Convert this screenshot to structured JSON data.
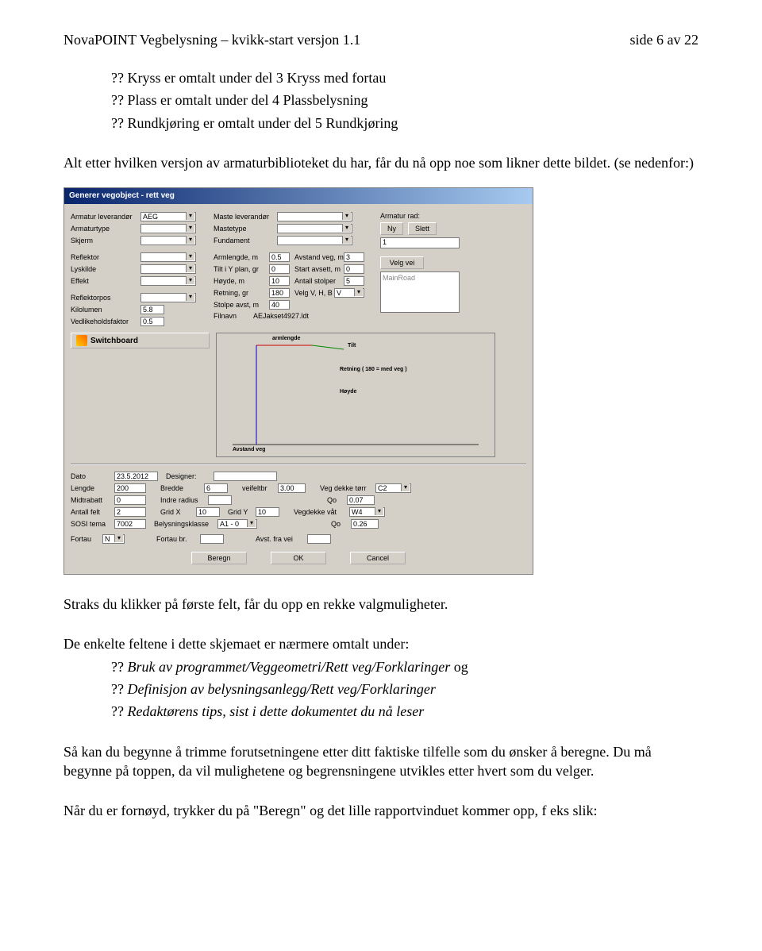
{
  "header": {
    "title": "NovaPOINT Vegbelysning – kvikk-start versjon 1.1",
    "page": "side 6 av 22"
  },
  "intro": {
    "l1": "?? Kryss er omtalt under del 3 Kryss med fortau",
    "l2": "?? Plass er omtalt under del 4 Plassbelysning",
    "l3": "?? Rundkjøring er omtalt under del 5 Rundkjøring"
  },
  "para1": "Alt etter hvilken versjon av armaturbiblioteket du har, får du nå opp noe som likner dette bildet. (se nedenfor:)",
  "dialog": {
    "title": "Generer vegobject - rett veg",
    "armatur": {
      "lev_lbl": "Armatur leverandør",
      "lev_val": "AEG",
      "typ_lbl": "Armaturtype",
      "skj_lbl": "Skjerm",
      "ref_lbl": "Reflektor",
      "lys_lbl": "Lyskilde",
      "eff_lbl": "Effekt",
      "rpos_lbl": "Reflektorpos",
      "kilo_lbl": "Kilolumen",
      "kilo_val": "5.8",
      "vedl_lbl": "Vedlikeholdsfaktor",
      "vedl_val": "0.5"
    },
    "maste": {
      "lev_lbl": "Maste leverandør",
      "typ_lbl": "Mastetype",
      "fund_lbl": "Fundament",
      "arm_lbl": "Armlengde, m",
      "arm_val": "0.5",
      "tilt_lbl": "Tilt i Y plan, gr",
      "tilt_val": "0",
      "hoy_lbl": "Høyde, m",
      "hoy_val": "10",
      "ret_lbl": "Retning, gr",
      "ret_val": "180",
      "stop_lbl": "Stolpe avst, m",
      "stop_val": "40",
      "fil_lbl": "Filnavn",
      "fil_val": "AEJakset4927.ldt"
    },
    "geo": {
      "avs_lbl": "Avstand veg, m",
      "avs_val": "3",
      "sta_lbl": "Start avsett, m",
      "sta_val": "0",
      "ant_lbl": "Antall stolper",
      "ant_val": "5",
      "velg_lbl": "Velg V, H, B",
      "velg_val": "V",
      "mainroad": "MainRoad"
    },
    "rad": {
      "lbl": "Armatur rad:",
      "ny": "Ny",
      "slett": "Slett",
      "val": "1",
      "velg_btn": "Velg vei"
    },
    "switchboard": "Switchboard",
    "preview": {
      "arm_lbl": "armlengde",
      "tilt_lbl": "Tilt",
      "retn_lbl": "Retning ( 180 = med veg )",
      "hoyde_lbl": "Høyde",
      "avst_lbl": "Avstand veg"
    },
    "bottom": {
      "dato_lbl": "Dato",
      "dato_val": "23.5.2012",
      "designer_lbl": "Designer:",
      "len_lbl": "Lengde",
      "len_val": "200",
      "bre_lbl": "Bredde",
      "bre_val": "6",
      "vfb_lbl": "veifeltbr",
      "vfb_val": "3.00",
      "vdt_lbl": "Veg dekke tørr",
      "vdt_val": "C2",
      "mid_lbl": "Midtrabatt",
      "mid_val": "0",
      "ind_lbl": "Indre radius",
      "ind_val": "",
      "qo1_lbl": "Qo",
      "qo1_val": "0.07",
      "ant_lbl": "Antall felt",
      "ant_val": "2",
      "gx_lbl": "Grid X",
      "gx_val": "10",
      "gy_lbl": "Grid Y",
      "gy_val": "10",
      "vdv_lbl": "Vegdekke våt",
      "vdv_val": "W4",
      "sosi_lbl": "SOSI tema",
      "sosi_val": "7002",
      "bel_lbl": "Belysningsklasse",
      "bel_val": "A1 - 0",
      "qo2_lbl": "Qo",
      "qo2_val": "0.26",
      "for_lbl": "Fortau",
      "for_val": "N",
      "forb_lbl": "Fortau br.",
      "avst_lbl": "Avst. fra vei"
    },
    "buttons": {
      "b1": "Beregn",
      "b2": "OK",
      "b3": "Cancel"
    }
  },
  "after": {
    "p1": "Straks du klikker på første felt, får du opp en rekke valgmuligheter.",
    "p2": "De enkelte feltene i dette skjemaet er nærmere omtalt under:",
    "b1a": "?? ",
    "b1b": "Bruk av programmet/Veggeometri/Rett veg/Forklaringer",
    "b1c": " og",
    "b2a": "?? ",
    "b2b": "Definisjon av belysningsanlegg/Rett veg/Forklaringer",
    "b3a": "?? ",
    "b3b": "Redaktørens tips, sist i dette dokumentet du nå leser",
    "p3": "Så kan du begynne å trimme forutsetningene etter ditt faktiske tilfelle som du ønsker å beregne. Du må begynne på toppen, da vil mulighetene og begrensningene utvikles etter hvert som du velger.",
    "p4": "Når du er fornøyd, trykker du på \"Beregn\" og det lille rapportvinduet kommer opp, f eks slik:"
  }
}
